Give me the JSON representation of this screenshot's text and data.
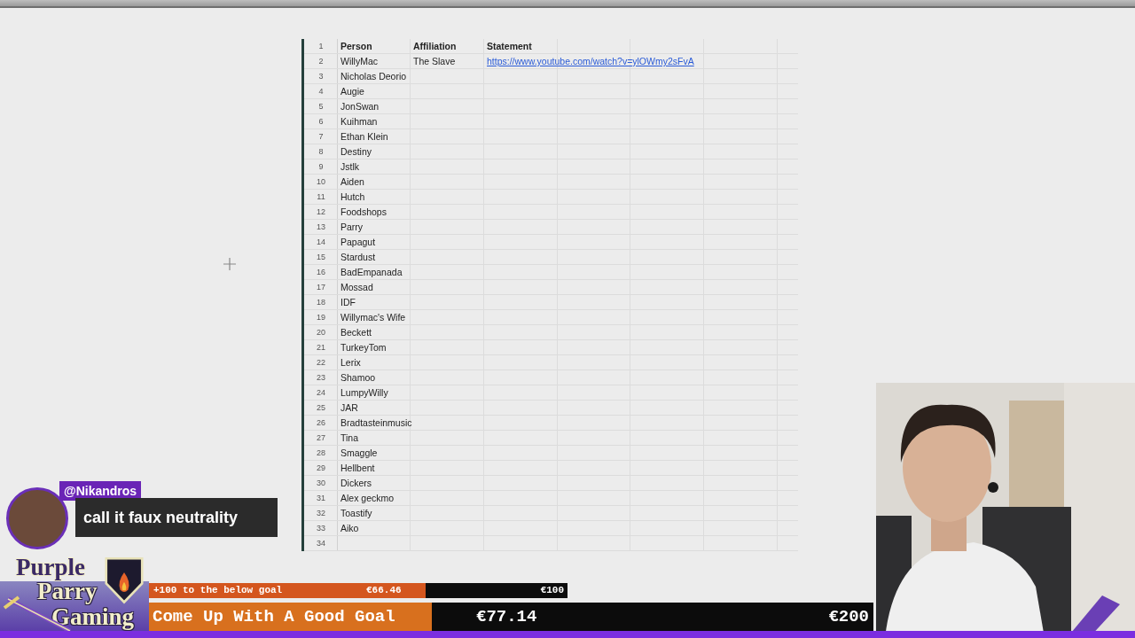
{
  "sheet": {
    "header": {
      "number": "1",
      "cells": [
        "Person",
        "Affiliation",
        "Statement"
      ]
    },
    "rows": [
      {
        "number": "2",
        "person": "WillyMac",
        "affiliation": "The Slave",
        "statement": "https://www.youtube.com/watch?v=ylOWmy2sFvA"
      },
      {
        "number": "3",
        "person": "Nicholas Deorio"
      },
      {
        "number": "4",
        "person": "Augie"
      },
      {
        "number": "5",
        "person": "JonSwan"
      },
      {
        "number": "6",
        "person": "Kuihman"
      },
      {
        "number": "7",
        "person": "Ethan Klein"
      },
      {
        "number": "8",
        "person": "Destiny"
      },
      {
        "number": "9",
        "person": "Jstlk"
      },
      {
        "number": "10",
        "person": "Aiden"
      },
      {
        "number": "11",
        "person": "Hutch"
      },
      {
        "number": "12",
        "person": "Foodshops"
      },
      {
        "number": "13",
        "person": "Parry"
      },
      {
        "number": "14",
        "person": "Papagut"
      },
      {
        "number": "15",
        "person": "Stardust"
      },
      {
        "number": "16",
        "person": "BadEmpanada"
      },
      {
        "number": "17",
        "person": "Mossad"
      },
      {
        "number": "18",
        "person": "IDF"
      },
      {
        "number": "19",
        "person": "Willymac's Wife"
      },
      {
        "number": "20",
        "person": "Beckett"
      },
      {
        "number": "21",
        "person": "TurkeyTom"
      },
      {
        "number": "22",
        "person": "Lerix"
      },
      {
        "number": "23",
        "person": "Shamoo"
      },
      {
        "number": "24",
        "person": "LumpyWilly"
      },
      {
        "number": "25",
        "person": "JAR"
      },
      {
        "number": "26",
        "person": "Bradtasteinmusic"
      },
      {
        "number": "27",
        "person": "Tina"
      },
      {
        "number": "28",
        "person": "Smaggle"
      },
      {
        "number": "29",
        "person": "Hellbent"
      },
      {
        "number": "30",
        "person": "Dickers"
      },
      {
        "number": "31",
        "person": "Alex geckmo"
      },
      {
        "number": "32",
        "person": "Toastify"
      },
      {
        "number": "33",
        "person": "Aiko"
      },
      {
        "number": "34"
      }
    ]
  },
  "chat": {
    "username": "@Nikandros",
    "message": "call it faux neutrality"
  },
  "logo": {
    "lines": [
      "Purple",
      "Parry",
      "Gaming"
    ]
  },
  "goals": [
    {
      "kind": "small",
      "label": "+100 to the below goal",
      "amount": "€66.46",
      "target": "€100",
      "level": 0.66
    },
    {
      "kind": "large",
      "label": "Come Up With A Good Goal",
      "amount": "€77.14",
      "target": "€200",
      "level": 0.39
    }
  ]
}
